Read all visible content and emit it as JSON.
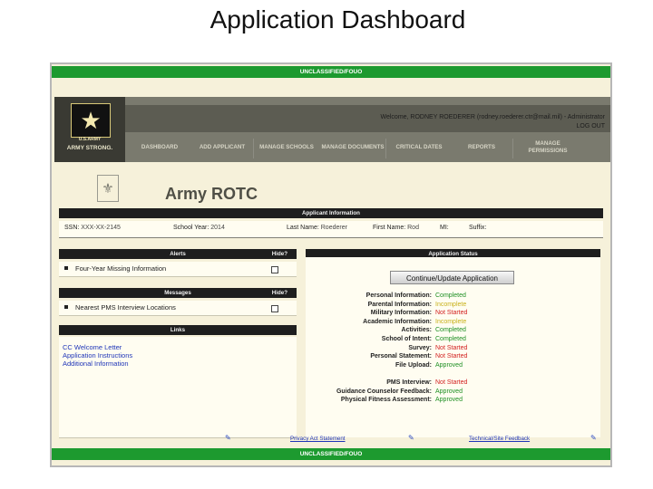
{
  "slide_title": "Application Dashboard",
  "classification": "UNCLASSIFIED/FOUO",
  "header": {
    "welcome": "Welcome, RODNEY ROEDERER (rodney.roederer.ctr@mail.mil) - Administrator",
    "logout": "LOG OUT",
    "logo_line1": "U.S.ARMY",
    "logo_line2": "ARMY STRONG."
  },
  "nav": [
    "DASHBOARD",
    "ADD APPLICANT",
    "MANAGE SCHOOLS",
    "MANAGE DOCUMENTS",
    "CRITICAL DATES",
    "REPORTS",
    "MANAGE PERMISSIONS"
  ],
  "brand": "Army ROTC",
  "applicant_info": {
    "title": "Applicant Information",
    "ssn_label": "SSN:",
    "ssn": "XXX-XX-2145",
    "school_year_label": "School Year:",
    "school_year": "2014",
    "last_name_label": "Last Name:",
    "last_name": "Roederer",
    "first_name_label": "First Name:",
    "first_name": "Rod",
    "mi_label": "MI:",
    "suffix_label": "Suffix:"
  },
  "alerts": {
    "title": "Alerts",
    "hide": "Hide?",
    "items": [
      "Four-Year Missing Information"
    ]
  },
  "messages": {
    "title": "Messages",
    "hide": "Hide?",
    "items": [
      "Nearest PMS Interview Locations"
    ]
  },
  "links": {
    "title": "Links",
    "items": [
      "CC Welcome Letter",
      "Application Instructions",
      "Additional Information"
    ]
  },
  "application_status": {
    "title": "Application Status",
    "button": "Continue/Update Application",
    "rows": [
      {
        "label": "Personal Information:",
        "value": "Completed",
        "color": "#1d8f22"
      },
      {
        "label": "Parental Information:",
        "value": "Incomplete",
        "color": "#c8b018"
      },
      {
        "label": "Military Information:",
        "value": "Not Started",
        "color": "#d21f1f"
      },
      {
        "label": "Academic Information:",
        "value": "Incomplete",
        "color": "#c8b018"
      },
      {
        "label": "Activities:",
        "value": "Completed",
        "color": "#1d8f22"
      },
      {
        "label": "School of Intent:",
        "value": "Completed",
        "color": "#1d8f22"
      },
      {
        "label": "Survey:",
        "value": "Not Started",
        "color": "#d21f1f"
      },
      {
        "label": "Personal Statement:",
        "value": "Not Started",
        "color": "#d21f1f"
      },
      {
        "label": "File Upload:",
        "value": "Approved",
        "color": "#1d8f22"
      },
      {
        "label": "",
        "value": "",
        "color": "#000000"
      },
      {
        "label": "PMS Interview:",
        "value": "Not Started",
        "color": "#d21f1f"
      },
      {
        "label": "Guidance Counselor Feedback:",
        "value": "Approved",
        "color": "#1d8f22"
      },
      {
        "label": "Physical Fitness Assessment:",
        "value": "Approved",
        "color": "#1d8f22"
      }
    ]
  },
  "footer": {
    "privacy": "Privacy Act Statement",
    "feedback": "Technical/Site Feedback"
  }
}
